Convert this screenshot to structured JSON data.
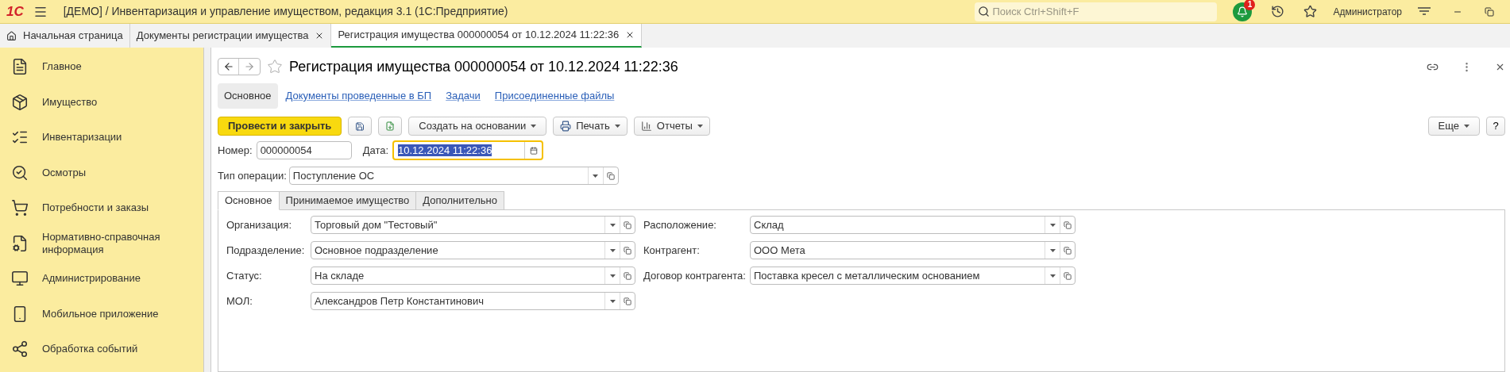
{
  "app": {
    "logo": "1С",
    "title": "[ДЕМО] / Инвентаризация и управление имуществом, редакция 3.1  (1С:Предприятие)",
    "search": {
      "placeholder": "Поиск Ctrl+Shift+F"
    },
    "notifications": "1",
    "user": "Администратор"
  },
  "open_tabs": [
    {
      "label": "Начальная страница",
      "selected": false,
      "kind": "home"
    },
    {
      "label": "Документы регистрации имущества",
      "selected": false,
      "kind": "doc"
    },
    {
      "label": "Регистрация имущества 000000054 от 10.12.2024 11:22:36",
      "selected": true,
      "kind": "doc"
    }
  ],
  "sidebar": {
    "items": [
      {
        "label": "Главное"
      },
      {
        "label": "Имущество"
      },
      {
        "label": "Инвентаризации"
      },
      {
        "label": "Осмотры"
      },
      {
        "label": "Потребности и заказы"
      },
      {
        "label": "Нормативно-справочная информация"
      },
      {
        "label": "Администрирование"
      },
      {
        "label": "Мобильное приложение"
      },
      {
        "label": "Обработка событий"
      }
    ]
  },
  "form": {
    "title": "Регистрация имущества 000000054 от 10.12.2024 11:22:36",
    "favorite": false,
    "nav": [
      {
        "label": "Основное",
        "selected": true
      },
      {
        "label": "Документы проведенные в БП",
        "selected": false
      },
      {
        "label": "Задачи",
        "selected": false
      },
      {
        "label": "Присоединенные файлы",
        "selected": false
      }
    ],
    "toolbar": [
      {
        "kind": "primary",
        "label": "Провести и закрыть"
      },
      {
        "kind": "save"
      },
      {
        "kind": "post"
      },
      {
        "kind": "menu",
        "label": "Создать на основании"
      },
      {
        "kind": "print",
        "label": "Печать"
      },
      {
        "kind": "reports",
        "label": "Отчеты"
      }
    ],
    "more_button": "Еще",
    "help_button": "?",
    "number": {
      "label": "Номер:",
      "value": "000000054"
    },
    "date": {
      "label": "Дата:",
      "value": "10.12.2024 11:22:36",
      "focused": true
    },
    "operation": {
      "label": "Тип операции:",
      "value": "Поступление ОС"
    },
    "tabs": [
      {
        "label": "Основное",
        "selected": true
      },
      {
        "label": "Принимаемое имущество",
        "selected": false
      },
      {
        "label": "Дополнительно",
        "selected": false
      }
    ],
    "left_fields": [
      {
        "label": "Организация:",
        "value": "Торговый дом \"Тестовый\""
      },
      {
        "label": "Подразделение:",
        "value": "Основное подразделение"
      },
      {
        "label": "Статус:",
        "value": "На складе"
      },
      {
        "label": "МОЛ:",
        "value": "Александров Петр Константинович"
      }
    ],
    "right_fields": [
      {
        "label": "Расположение:",
        "value": "Склад"
      },
      {
        "label": "Контрагент:",
        "value": "ООО Мета"
      },
      {
        "label": "Договор контрагента:",
        "value": "Поставка кресел с металлическим основанием"
      }
    ]
  }
}
